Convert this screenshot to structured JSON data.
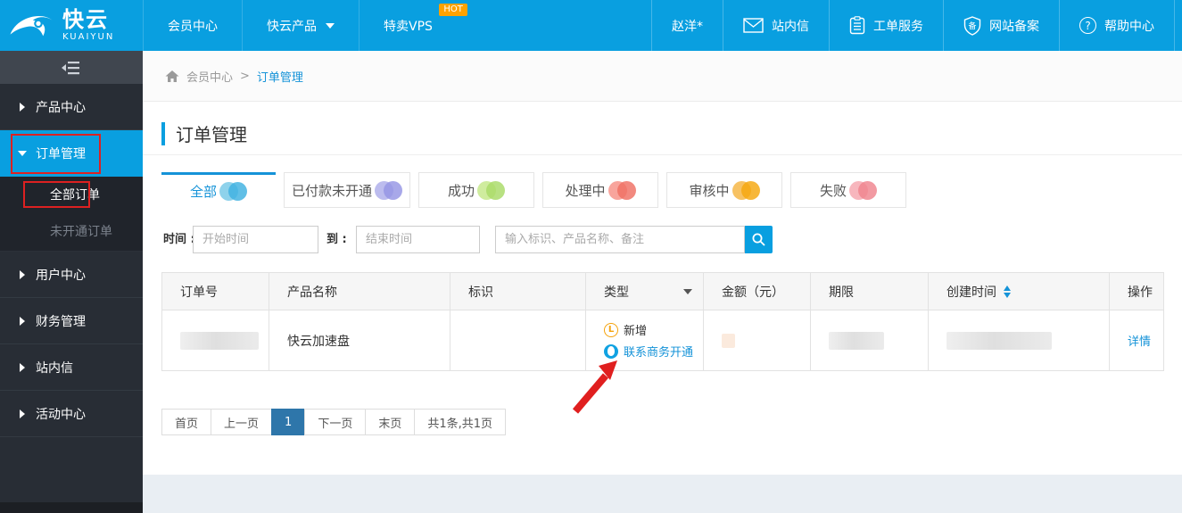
{
  "colors": {
    "primary_blue": "#099fe0",
    "link_blue": "#1593d8",
    "sidebar_dark": "#282d35",
    "hot_badge_orange": "#ffa200",
    "pagination_active": "#2e76aa",
    "annotation_red": "#dd2121",
    "footer_strip": "#e9eef3"
  },
  "topnav": {
    "logo_title": "快云",
    "logo_subtitle": "KUAIYUN",
    "menu": [
      {
        "label": "会员中心"
      },
      {
        "label": "快云产品"
      },
      {
        "label": "特卖VPS",
        "badge": "HOT"
      }
    ],
    "user": "赵洋*",
    "right": [
      {
        "label": "站内信",
        "icon": "mail-icon"
      },
      {
        "label": "工单服务",
        "icon": "work-order-icon"
      },
      {
        "label": "网站备案",
        "icon": "shield-icon",
        "glyph": "备"
      },
      {
        "label": "帮助中心",
        "icon": "help-icon",
        "glyph": "?"
      }
    ]
  },
  "sidebar": {
    "items": [
      {
        "label": "产品中心"
      },
      {
        "label": "订单管理",
        "state": "active"
      },
      {
        "label": "全部订单",
        "state": "selected-sub"
      },
      {
        "label": "未开通订单",
        "state": "dim-sub"
      },
      {
        "label": "用户中心"
      },
      {
        "label": "财务管理"
      },
      {
        "label": "站内信"
      },
      {
        "label": "活动中心"
      }
    ]
  },
  "breadcrumb": {
    "home": "会员中心",
    "separator": ">",
    "current": "订单管理"
  },
  "page_title": "订单管理",
  "tabs": [
    {
      "label": "全部",
      "active": true,
      "icon_a": "background:#8ed2eb",
      "icon_b": "background:#3eb1e0"
    },
    {
      "label": "已付款未开通",
      "icon_a": "background:#bcbcee",
      "icon_b": "background:#9595e4"
    },
    {
      "label": "成功",
      "icon_a": "background:#cfec9e",
      "icon_b": "background:#a8da67"
    },
    {
      "label": "处理中",
      "icon_a": "background:#f8a49c",
      "icon_b": "background:#ef6f63"
    },
    {
      "label": "审核中",
      "icon_a": "background:#f7c263",
      "icon_b": "background:#f5a70d"
    },
    {
      "label": "失败",
      "icon_a": "background:#f7b6bd",
      "icon_b": "background:#ef848e"
    }
  ],
  "filters": {
    "time_label": "时间 :",
    "start_placeholder": "开始时间",
    "to_label": "到 :",
    "end_placeholder": "结束时间",
    "search_placeholder": "输入标识、产品名称、备注"
  },
  "table": {
    "headers": [
      "订单号",
      "产品名称",
      "标识",
      "类型",
      "金额（元）",
      "期限",
      "创建时间",
      "操作"
    ],
    "row": {
      "product_name": "快云加速盘",
      "type_new": "新增",
      "type_new_glyph": "L",
      "type_contact": "联系商务开通",
      "action": "详情"
    }
  },
  "pagination": {
    "first": "首页",
    "prev": "上一页",
    "current": "1",
    "next": "下一页",
    "last": "末页",
    "summary": "共1条,共1页"
  }
}
